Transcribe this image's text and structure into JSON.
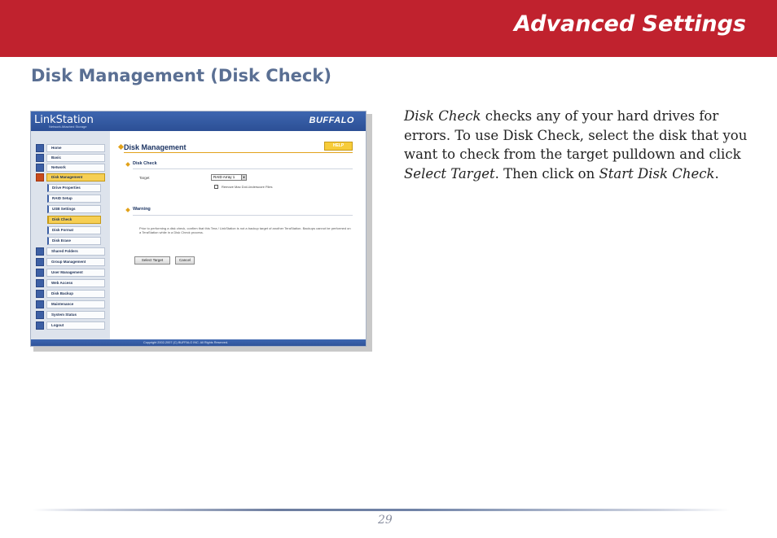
{
  "header": {
    "title": "Advanced Settings"
  },
  "section": {
    "title": "Disk Management (Disk Check)"
  },
  "description": {
    "p1_em": "Disk Check",
    "p1_a": " checks any of your hard drives for errors.  To use Disk Check, select the disk that you want to check from the target pulldown and click ",
    "p1_em2": "Select Target",
    "p1_b": ".  Then click on ",
    "p1_em3": "Start Disk Check",
    "p1_c": "."
  },
  "screenshot": {
    "logo": "LinkStation",
    "logo_sub": "Network Attached Storage",
    "brand": "BUFFALO",
    "nav": [
      {
        "label": "Home",
        "icon": "home-icon"
      },
      {
        "label": "Basic",
        "icon": "basic-icon"
      },
      {
        "label": "Network",
        "icon": "network-icon"
      },
      {
        "label": "Disk Management",
        "icon": "disk-icon",
        "active": true
      }
    ],
    "subnav": [
      {
        "label": "Drive Properties"
      },
      {
        "label": "RAID Setup"
      },
      {
        "label": "USB Settings"
      },
      {
        "label": "Disk Check",
        "active": true
      },
      {
        "label": "Disk Format"
      },
      {
        "label": "Disk Erase"
      }
    ],
    "nav2": [
      {
        "label": "Shared Folders",
        "icon": "folder-icon"
      },
      {
        "label": "Group Management",
        "icon": "group-icon"
      },
      {
        "label": "User Management",
        "icon": "user-icon"
      },
      {
        "label": "Web Access",
        "icon": "web-icon"
      },
      {
        "label": "Disk Backup",
        "icon": "backup-icon"
      },
      {
        "label": "Maintenance",
        "icon": "maintenance-icon"
      },
      {
        "label": "System Status",
        "icon": "status-icon"
      },
      {
        "label": "Logout",
        "icon": "logout-icon"
      }
    ],
    "main_title": "Disk Management",
    "help": "HELP",
    "disk_check_title": "Disk Check",
    "target_label": "Target",
    "target_value": "RAID Array 1",
    "checkbox_label": "Remove Mac Dot-Underscore Files",
    "warning_title": "Warning",
    "warning_text": "Prior to performing a disk check, confirm that this Tera / LinkStation is not a backup target of another TeraStation. Backups cannot be performed on a TeraStation while in a Disk Check process.",
    "btn_select": "Select Target",
    "btn_cancel": "Cancel",
    "footer": "Copyright 2002-2007 (C) BUFFALO INC. All Rights Reserved."
  },
  "page_number": "29"
}
